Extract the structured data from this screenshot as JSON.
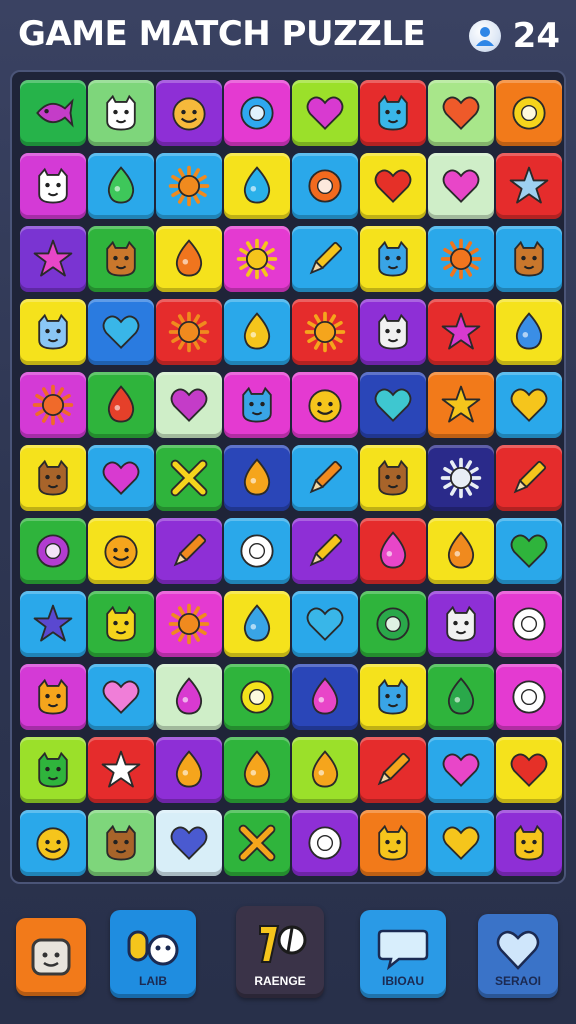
{
  "header": {
    "title": "GAME MATCH PUZZLE",
    "score": "24",
    "score_icon": "player-icon"
  },
  "board": {
    "rows": [
      [
        {
          "bg": "#26b34a",
          "fg": "#c43cc8",
          "icon": "fish"
        },
        {
          "bg": "#7ed67b",
          "fg": "#ffffff",
          "icon": "creature"
        },
        {
          "bg": "#8e2fd6",
          "fg": "#f6b93b",
          "icon": "smile"
        },
        {
          "bg": "#e43ad1",
          "fg": "#2ea8f0",
          "icon": "ring"
        },
        {
          "bg": "#9be02a",
          "fg": "#d83ad0",
          "icon": "heart"
        },
        {
          "bg": "#e52c2c",
          "fg": "#39b6e8",
          "icon": "creature"
        },
        {
          "bg": "#a8e68a",
          "fg": "#ee5a2a",
          "icon": "heart"
        },
        {
          "bg": "#f27a1a",
          "fg": "#f5d41c",
          "icon": "ring"
        }
      ],
      [
        {
          "bg": "#d43ad6",
          "fg": "#ffffff",
          "icon": "creature"
        },
        {
          "bg": "#2aa8ea",
          "fg": "#3ec75a",
          "icon": "drop"
        },
        {
          "bg": "#2aa8ea",
          "fg": "#f08a1e",
          "icon": "sun"
        },
        {
          "bg": "#f5e21c",
          "fg": "#2ab0ea",
          "icon": "drop"
        },
        {
          "bg": "#2aa8ea",
          "fg": "#f26a1e",
          "icon": "ring"
        },
        {
          "bg": "#f5e21c",
          "fg": "#e53028",
          "icon": "heart"
        },
        {
          "bg": "#cfeec8",
          "fg": "#e846c8",
          "icon": "heart"
        },
        {
          "bg": "#e52c2c",
          "fg": "#9ed0f0",
          "icon": "star"
        }
      ],
      [
        {
          "bg": "#7a34d2",
          "fg": "#e846c8",
          "icon": "star"
        },
        {
          "bg": "#2fb43c",
          "fg": "#c9772c",
          "icon": "creature"
        },
        {
          "bg": "#f5e21c",
          "fg": "#f0751e",
          "icon": "drop"
        },
        {
          "bg": "#e43ad1",
          "fg": "#f5c51c",
          "icon": "sun"
        },
        {
          "bg": "#2aa8ea",
          "fg": "#f5c51c",
          "icon": "pencil"
        },
        {
          "bg": "#f5e21c",
          "fg": "#39a4e6",
          "icon": "creature"
        },
        {
          "bg": "#2aa8ea",
          "fg": "#f0751e",
          "icon": "sun"
        },
        {
          "bg": "#2aa8ea",
          "fg": "#c9772c",
          "icon": "creature"
        }
      ],
      [
        {
          "bg": "#f5e21c",
          "fg": "#8ac6f5",
          "icon": "creature"
        },
        {
          "bg": "#2a7be0",
          "fg": "#39b6e8",
          "icon": "heart"
        },
        {
          "bg": "#e52c2c",
          "fg": "#f08a1e",
          "icon": "sun"
        },
        {
          "bg": "#2aa8ea",
          "fg": "#f5c51c",
          "icon": "drop"
        },
        {
          "bg": "#e52c2c",
          "fg": "#f5a51c",
          "icon": "sun"
        },
        {
          "bg": "#8e2fd6",
          "fg": "#f1f1f1",
          "icon": "creature"
        },
        {
          "bg": "#e52c2c",
          "fg": "#d83ad0",
          "icon": "star"
        },
        {
          "bg": "#f5e21c",
          "fg": "#3a8ee6",
          "icon": "drop"
        }
      ],
      [
        {
          "bg": "#d43ad6",
          "fg": "#f06a2a",
          "icon": "sun"
        },
        {
          "bg": "#2fb43c",
          "fg": "#e5402a",
          "icon": "drop"
        },
        {
          "bg": "#cfeec8",
          "fg": "#c43cc8",
          "icon": "heart"
        },
        {
          "bg": "#e43ad1",
          "fg": "#39a4e6",
          "icon": "creature"
        },
        {
          "bg": "#e43ad1",
          "fg": "#f5c51c",
          "icon": "smile"
        },
        {
          "bg": "#2a46b8",
          "fg": "#3ec7d0",
          "icon": "heart"
        },
        {
          "bg": "#f27a1a",
          "fg": "#f5c51c",
          "icon": "star"
        },
        {
          "bg": "#2aa8ea",
          "fg": "#f5c51c",
          "icon": "heart"
        }
      ],
      [
        {
          "bg": "#f5e21c",
          "fg": "#a8642a",
          "icon": "creature"
        },
        {
          "bg": "#2aa8ea",
          "fg": "#d83ad0",
          "icon": "heart"
        },
        {
          "bg": "#2fb43c",
          "fg": "#f5d41c",
          "icon": "cross"
        },
        {
          "bg": "#2a46b8",
          "fg": "#f5a51c",
          "icon": "drop"
        },
        {
          "bg": "#2aa8ea",
          "fg": "#f08a1e",
          "icon": "pencil"
        },
        {
          "bg": "#f5e21c",
          "fg": "#a8642a",
          "icon": "creature"
        },
        {
          "bg": "#2a2a8a",
          "fg": "#e8eef5",
          "icon": "sun"
        },
        {
          "bg": "#e52c2c",
          "fg": "#f5c51c",
          "icon": "pencil"
        }
      ],
      [
        {
          "bg": "#2fb43c",
          "fg": "#b23cd0",
          "icon": "ring"
        },
        {
          "bg": "#f5e21c",
          "fg": "#f5a51c",
          "icon": "smile"
        },
        {
          "bg": "#8e2fd6",
          "fg": "#f08a1e",
          "icon": "pencil"
        },
        {
          "bg": "#2aa8ea",
          "fg": "#ffffff",
          "icon": "ring"
        },
        {
          "bg": "#8e2fd6",
          "fg": "#f5c51c",
          "icon": "pencil"
        },
        {
          "bg": "#e52c2c",
          "fg": "#e846c8",
          "icon": "drop"
        },
        {
          "bg": "#f5e21c",
          "fg": "#f08a1e",
          "icon": "drop"
        },
        {
          "bg": "#2aa8ea",
          "fg": "#2fb43c",
          "icon": "heart"
        }
      ],
      [
        {
          "bg": "#2aa8ea",
          "fg": "#5a48d0",
          "icon": "star"
        },
        {
          "bg": "#2fb43c",
          "fg": "#f5d41c",
          "icon": "creature"
        },
        {
          "bg": "#e43ad1",
          "fg": "#f08a1e",
          "icon": "sun"
        },
        {
          "bg": "#f5e21c",
          "fg": "#39a4e6",
          "icon": "drop"
        },
        {
          "bg": "#2aa8ea",
          "fg": "#39b6e8",
          "icon": "heart"
        },
        {
          "bg": "#2fb43c",
          "fg": "#2aa84a",
          "icon": "ring"
        },
        {
          "bg": "#8e2fd6",
          "fg": "#f1f1f1",
          "icon": "creature"
        },
        {
          "bg": "#e43ad1",
          "fg": "#ffffff",
          "icon": "ring"
        }
      ],
      [
        {
          "bg": "#d43ad6",
          "fg": "#f5a51c",
          "icon": "creature"
        },
        {
          "bg": "#2aa8ea",
          "fg": "#f07ed8",
          "icon": "heart"
        },
        {
          "bg": "#cfeec8",
          "fg": "#d83ad0",
          "icon": "drop"
        },
        {
          "bg": "#2fb43c",
          "fg": "#f5e21c",
          "icon": "ring"
        },
        {
          "bg": "#2a46b8",
          "fg": "#e846c8",
          "icon": "drop"
        },
        {
          "bg": "#f5e21c",
          "fg": "#39a4e6",
          "icon": "creature"
        },
        {
          "bg": "#2fb43c",
          "fg": "#2aa84a",
          "icon": "drop"
        },
        {
          "bg": "#e43ad1",
          "fg": "#ffffff",
          "icon": "ring"
        }
      ],
      [
        {
          "bg": "#9be02a",
          "fg": "#2fb43c",
          "icon": "creature"
        },
        {
          "bg": "#e52c2c",
          "fg": "#ffffff",
          "icon": "star"
        },
        {
          "bg": "#8e2fd6",
          "fg": "#f5a51c",
          "icon": "drop"
        },
        {
          "bg": "#2fb43c",
          "fg": "#f5a51c",
          "icon": "drop"
        },
        {
          "bg": "#9be02a",
          "fg": "#f5a51c",
          "icon": "drop"
        },
        {
          "bg": "#e52c2c",
          "fg": "#f5a51c",
          "icon": "pencil"
        },
        {
          "bg": "#2aa8ea",
          "fg": "#e846c8",
          "icon": "heart"
        },
        {
          "bg": "#f5e21c",
          "fg": "#e53028",
          "icon": "heart"
        }
      ],
      [
        {
          "bg": "#2aa8ea",
          "fg": "#f5c51c",
          "icon": "smile"
        },
        {
          "bg": "#7ed67b",
          "fg": "#a8642a",
          "icon": "creature"
        },
        {
          "bg": "#d8eef8",
          "fg": "#4a5ad0",
          "icon": "heart"
        },
        {
          "bg": "#2fb43c",
          "fg": "#f5a51c",
          "icon": "cross"
        },
        {
          "bg": "#8e2fd6",
          "fg": "#ffffff",
          "icon": "ring"
        },
        {
          "bg": "#f27a1a",
          "fg": "#f5c51c",
          "icon": "creature"
        },
        {
          "bg": "#2aa8ea",
          "fg": "#f5c51c",
          "icon": "heart"
        },
        {
          "bg": "#8e2fd6",
          "fg": "#f5c51c",
          "icon": "creature"
        }
      ]
    ]
  },
  "toolbar": {
    "buttons": [
      {
        "label": "",
        "icon": "toast-icon",
        "bg": "#f27a1a"
      },
      {
        "label": "LAIB",
        "icon": "key-face-icon",
        "bg": "#1f8de0"
      },
      {
        "label": "RAENGE",
        "icon": "magnet-icon",
        "bg": "#3a3348"
      },
      {
        "label": "IBIOAU",
        "icon": "chat-bubble-icon",
        "bg": "#2a9ae6"
      },
      {
        "label": "SERAOI",
        "icon": "heart-bubble-icon",
        "bg": "#3a73c8"
      }
    ]
  }
}
